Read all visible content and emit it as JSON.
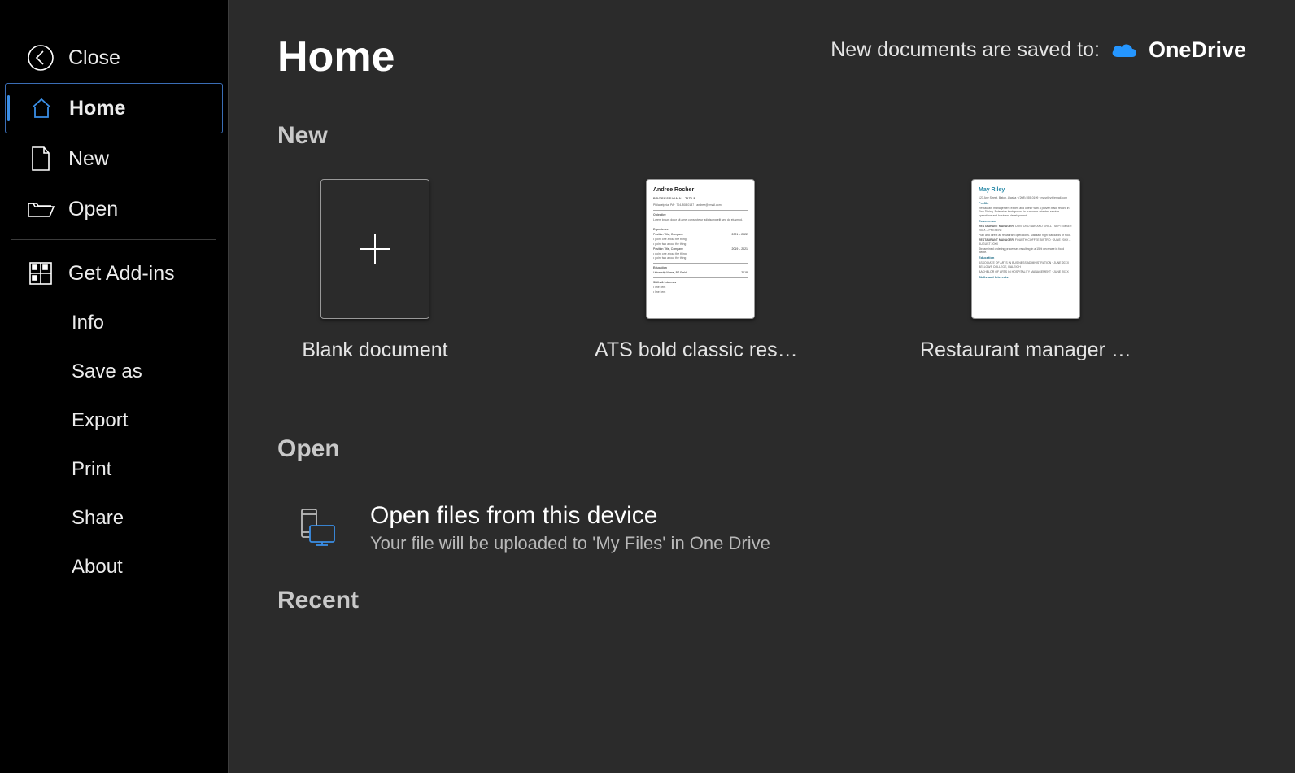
{
  "sidebar": {
    "close": "Close",
    "home": "Home",
    "new": "New",
    "open": "Open",
    "addins": "Get Add-ins",
    "info": "Info",
    "saveas": "Save as",
    "export": "Export",
    "print": "Print",
    "share": "Share",
    "about": "About"
  },
  "header": {
    "title": "Home",
    "save_note": "New documents are saved to:",
    "onedrive": "OneDrive"
  },
  "sections": {
    "new": "New",
    "open": "Open",
    "recent": "Recent"
  },
  "templates": [
    {
      "label": "Blank document",
      "kind": "blank"
    },
    {
      "label": "ATS bold classic resu…",
      "kind": "resume",
      "name": "Andree Rocher",
      "subtitle": "PROFESSIONAL TITLE"
    },
    {
      "label": "Restaurant manager r…",
      "kind": "teal",
      "name": "May Riley"
    }
  ],
  "open_action": {
    "title": "Open files from this device",
    "subtitle": "Your file will be uploaded to 'My Files' in One Drive"
  }
}
